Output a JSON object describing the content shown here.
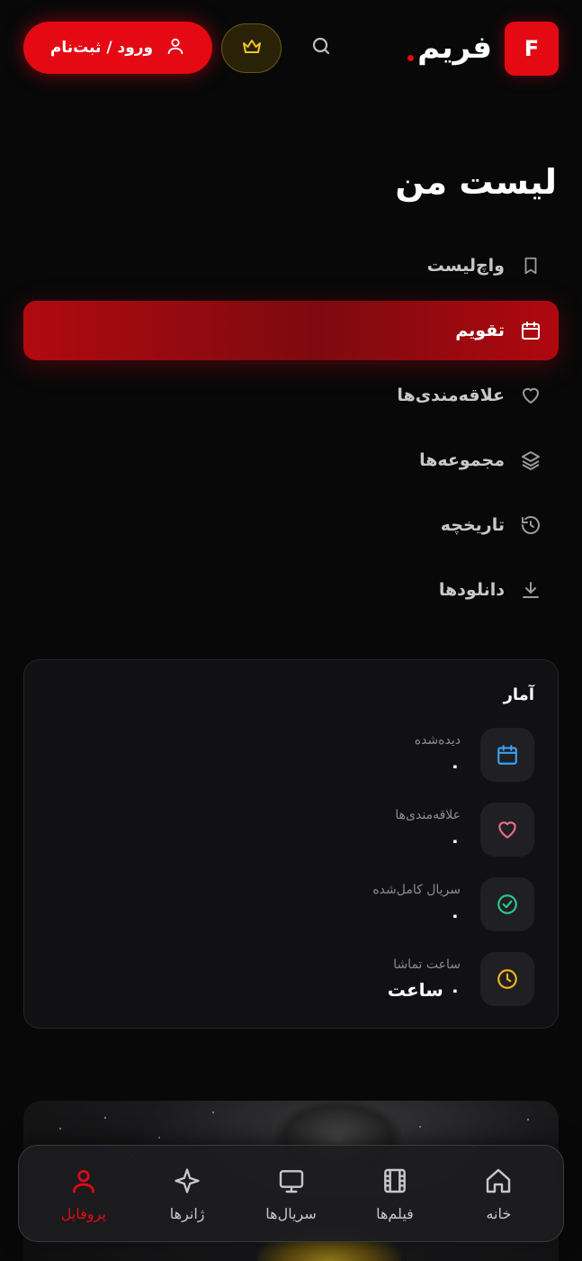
{
  "header": {
    "logo_letter": "F",
    "brand": "فریم",
    "login_label": "ورود / ثبت‌نام",
    "icons": {
      "user": "user-icon",
      "crown": "crown-icon",
      "search": "search-icon"
    }
  },
  "my_list": {
    "title": "لیست من",
    "items": [
      {
        "label": "واچ‌لیست",
        "icon": "bookmark-icon",
        "active": false
      },
      {
        "label": "تقویم",
        "icon": "calendar-icon",
        "active": true
      },
      {
        "label": "علاقه‌مندی‌ها",
        "icon": "heart-icon",
        "active": false
      },
      {
        "label": "مجموعه‌ها",
        "icon": "layers-icon",
        "active": false
      },
      {
        "label": "تاریخچه",
        "icon": "history-icon",
        "active": false
      },
      {
        "label": "دانلودها",
        "icon": "download-icon",
        "active": false
      }
    ]
  },
  "stats": {
    "title": "آمار",
    "items": [
      {
        "label": "دیده‌شده",
        "value": "۰",
        "icon": "calendar-icon",
        "color": "#3aa0f0"
      },
      {
        "label": "علاقه‌مندی‌ها",
        "value": "۰",
        "icon": "heart-icon",
        "color": "#f06b87"
      },
      {
        "label": "سریال کامل‌شده",
        "value": "۰",
        "icon": "check-circle-icon",
        "color": "#2fc58a"
      },
      {
        "label": "ساعت تماشا",
        "value": "۰ ساعت",
        "icon": "clock-icon",
        "color": "#f2b21c"
      }
    ]
  },
  "bottom_nav": {
    "items": [
      {
        "label": "خانه",
        "icon": "home-icon",
        "active": false
      },
      {
        "label": "فیلم‌ها",
        "icon": "film-icon",
        "active": false
      },
      {
        "label": "سریال‌ها",
        "icon": "tv-icon",
        "active": false
      },
      {
        "label": "ژانرها",
        "icon": "sparkle-icon",
        "active": false
      },
      {
        "label": "پروفایل",
        "icon": "user-icon",
        "active": true
      }
    ]
  },
  "colors": {
    "accent": "#e50914",
    "background": "#080809",
    "card": "#111114",
    "gold": "#f2c420"
  }
}
